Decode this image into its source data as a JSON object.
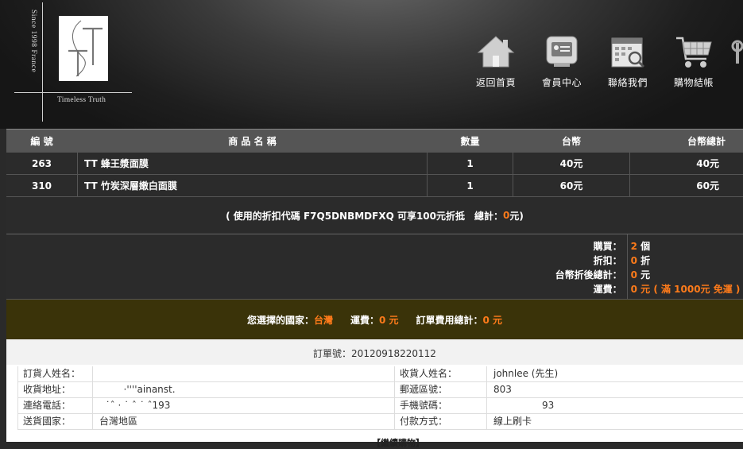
{
  "logo": {
    "since": "Since 1998 France",
    "tagline": "Timeless Truth",
    "mark": "TT"
  },
  "nav": [
    {
      "label": "返回首頁",
      "icon": "home-icon"
    },
    {
      "label": "會員中心",
      "icon": "member-card-icon"
    },
    {
      "label": "聯絡我們",
      "icon": "contact-calendar-icon"
    },
    {
      "label": "購物結帳",
      "icon": "shopping-cart-icon"
    }
  ],
  "table": {
    "headers": [
      "編 號",
      "商 品 名 稱",
      "數量",
      "台幣",
      "台幣總計"
    ],
    "rows": [
      {
        "id": "263",
        "name": "TT 蜂王漿面膜",
        "qty": "1",
        "price": "40元",
        "total": "40元"
      },
      {
        "id": "310",
        "name": "TT 竹炭深層嫩白面膜",
        "qty": "1",
        "price": "60元",
        "total": "60元"
      }
    ]
  },
  "coupon": {
    "prefix": "( 使用的折扣代碼 F7Q5DNBMDFXQ 可享100元折抵　總計：",
    "amount": "0",
    "suffix": "元)"
  },
  "summary": {
    "bought_label": "購買：",
    "bought_value": "2",
    "bought_unit": " 個",
    "discount_label": "折扣：",
    "discount_value": "0",
    "discount_unit": " 折",
    "after_label": "台幣折後總計：",
    "after_value": "0",
    "after_unit": " 元",
    "shipping_label": "運費：",
    "shipping_value": "0 元 ( 滿 1000元 免運 )"
  },
  "country_bar": {
    "country_label": "您選擇的國家：",
    "country_value": "台灣",
    "fee_label": "運費：",
    "fee_value": "0 元",
    "order_total_label": "訂單費用總計：",
    "order_total_value": "0 元"
  },
  "order_no": "訂單號：20120918220112",
  "info": {
    "rows": [
      {
        "l1": "訂貨人姓名：",
        "v1": "",
        "l2": "收貨人姓名：",
        "v2": "johnlee (先生)"
      },
      {
        "l1": "收貨地址：",
        "v1": "        ·''''ainanst.",
        "l2": "郵遞區號：",
        "v2": "803"
      },
      {
        "l1": "連絡電話：",
        "v1": "  ˙ˆ · ˙ ˆ ˙ ˆ193",
        "l2": "手機號碼：",
        "v2": "                93"
      },
      {
        "l1": "送貨國家：",
        "v1": "台灣地區",
        "l2": "付款方式：",
        "v2": "線上刷卡"
      }
    ],
    "cut_text": "【繼續購物】"
  },
  "colors": {
    "accent": "#ff7b1a",
    "country_bar": "#3a3309",
    "header_row": "#555555"
  }
}
